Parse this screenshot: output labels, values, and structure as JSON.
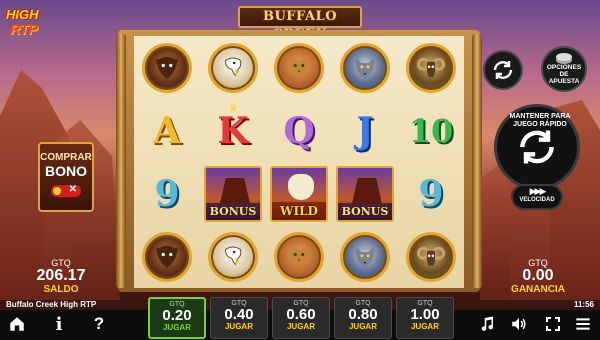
{
  "logo": {
    "line1": "HIGH",
    "line2": "RTP"
  },
  "title": "BUFFALO CREEK",
  "reels": [
    [
      "buffalo",
      "eagle",
      "puma",
      "wolf",
      "ram"
    ],
    [
      "A",
      "K",
      "Q",
      "J",
      "10"
    ],
    [
      "9",
      "bonus",
      "wild",
      "bonus",
      "9"
    ],
    [
      "buffalo",
      "eagle",
      "puma",
      "wolf",
      "ram"
    ]
  ],
  "special_labels": {
    "bonus": "BONUS",
    "wild": "WILD"
  },
  "buy_bonus": {
    "line1": "COMPRAR",
    "line2": "BONO",
    "toggle_x": "✕"
  },
  "balance": {
    "currency": "GTQ",
    "value": "206.17",
    "label": "SALDO"
  },
  "win": {
    "currency": "GTQ",
    "value": "0.00",
    "label": "GANANCIA"
  },
  "options_button": {
    "line1": "OPCIONES",
    "line2": "DE",
    "line3": "APUESTA"
  },
  "spin_button": {
    "hold_text": "MANTENER PARA JUEGO RÁPIDO"
  },
  "speed_button": {
    "label": "VELOCIDAD",
    "icon": "▶▶▶"
  },
  "game_name": "Buffalo Creek High RTP",
  "clock": "11:56",
  "bets": [
    {
      "currency": "GTQ",
      "value": "0.20",
      "label": "JUGAR",
      "selected": true
    },
    {
      "currency": "GTQ",
      "value": "0.40",
      "label": "JUGAR",
      "selected": false
    },
    {
      "currency": "GTQ",
      "value": "0.60",
      "label": "JUGAR",
      "selected": false
    },
    {
      "currency": "GTQ",
      "value": "0.80",
      "label": "JUGAR",
      "selected": false
    },
    {
      "currency": "GTQ",
      "value": "1.00",
      "label": "JUGAR",
      "selected": false
    }
  ],
  "bottom_icons": {
    "left": [
      "home-icon",
      "info-icon",
      "help-icon"
    ],
    "right": [
      "music-icon",
      "sound-icon",
      "fullscreen-icon",
      "menu-icon"
    ],
    "info_glyph": "i",
    "help_glyph": "?"
  },
  "colors": {
    "accent_yellow": "#ffd21f",
    "selected_green": "#7ad12a",
    "frame_gold": "#d9a441"
  }
}
